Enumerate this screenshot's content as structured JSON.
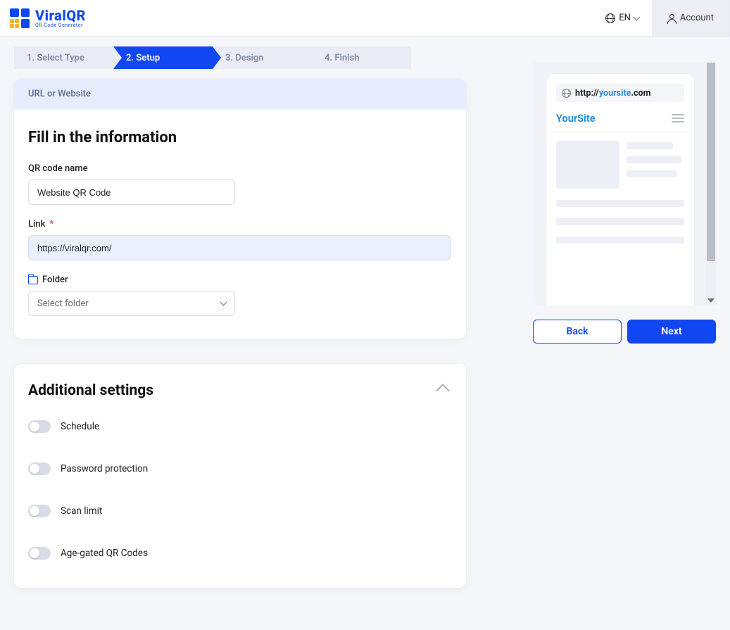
{
  "brand": {
    "name": "ViralQR",
    "tagline": "QR Code Generator"
  },
  "topbar": {
    "language": "EN",
    "account": "Account"
  },
  "wizard": [
    {
      "label": "1. Select Type",
      "active": false
    },
    {
      "label": "2. Setup",
      "active": true
    },
    {
      "label": "3. Design",
      "active": false
    },
    {
      "label": "4. Finish",
      "active": false
    }
  ],
  "card_header": "URL or Website",
  "form": {
    "heading": "Fill in the information",
    "name_label": "QR code name",
    "name_value": "Website QR Code",
    "link_label": "Link",
    "link_value": "https://viralqr.com/",
    "folder_label": "Folder",
    "folder_placeholder": "Select folder"
  },
  "additional": {
    "heading": "Additional settings",
    "items": [
      {
        "label": "Schedule",
        "on": false
      },
      {
        "label": "Password protection",
        "on": false
      },
      {
        "label": "Scan limit",
        "on": false
      },
      {
        "label": "Age-gated QR Codes",
        "on": false
      }
    ]
  },
  "preview": {
    "url_proto": "http://",
    "url_domain": "yoursite",
    "url_tld": ".com",
    "brand": "YourSite"
  },
  "actions": {
    "back": "Back",
    "next": "Next"
  }
}
